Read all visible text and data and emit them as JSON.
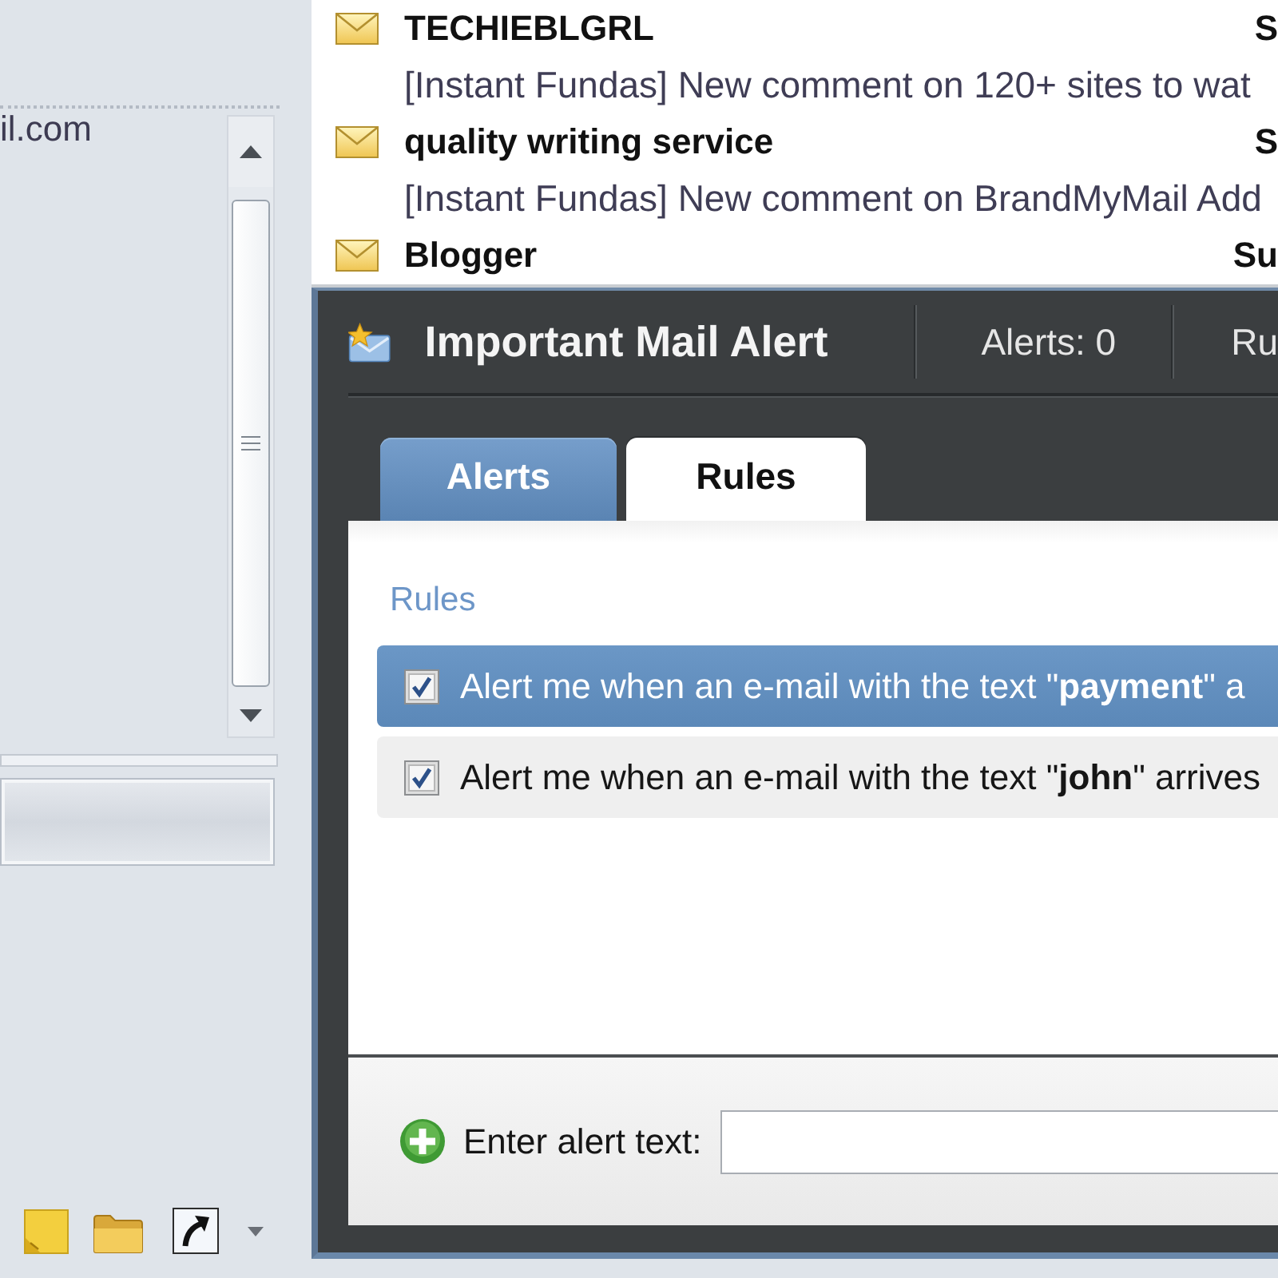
{
  "sidebar": {
    "account_text": "il.com"
  },
  "mail_list": {
    "messages": [
      {
        "sender": "TECHIEBLGRL",
        "date": "S",
        "subject": "[Instant Fundas] New comment on 120+ sites to wat"
      },
      {
        "sender": "quality writing service",
        "date": "S",
        "subject": "[Instant Fundas] New comment on BrandMyMail Add"
      },
      {
        "sender": "Blogger",
        "date": "Su"
      }
    ]
  },
  "alert_panel": {
    "title": "Important Mail Alert",
    "stats": [
      "Alerts: 0",
      "Ru"
    ],
    "tabs": [
      {
        "label": "Alerts",
        "selected": false
      },
      {
        "label": "Rules",
        "selected": true
      }
    ],
    "rules_heading": "Rules",
    "rules": [
      {
        "text": "Alert me when an e-mail with the text \"**payment**\" a",
        "checked": true,
        "selected": true
      },
      {
        "text": "Alert me when an e-mail with the text \"**john**\" arrives",
        "checked": true,
        "selected": false
      }
    ],
    "new_alert": {
      "label": "Enter alert text:"
    }
  }
}
